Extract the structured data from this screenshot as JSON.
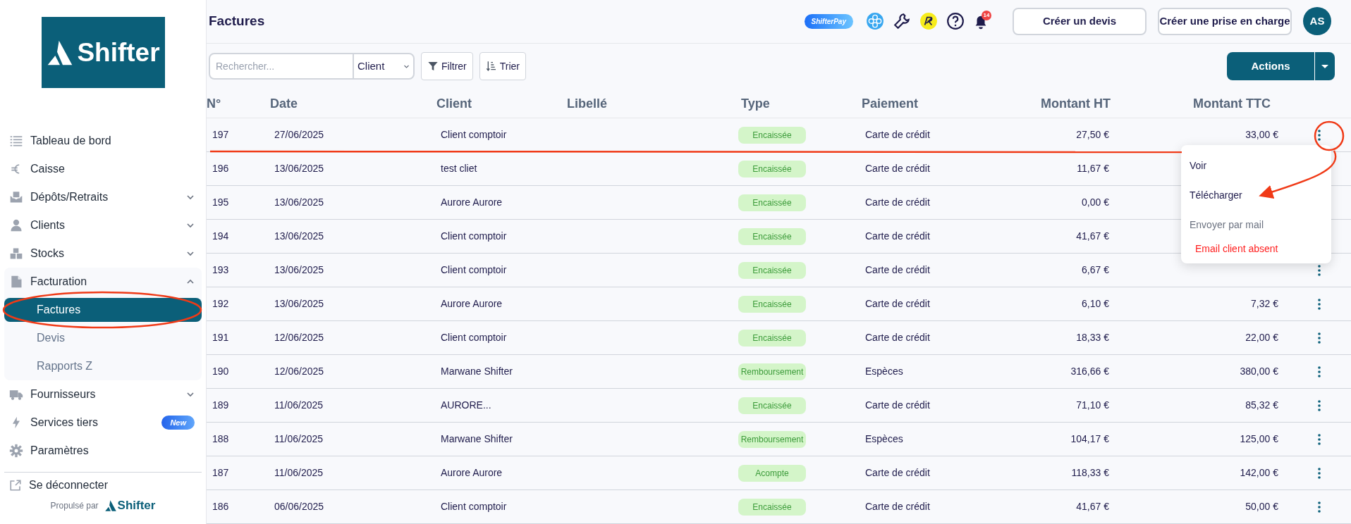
{
  "sidebar": {
    "logo": "Shifter",
    "items": [
      {
        "label": "Tableau de bord"
      },
      {
        "label": "Caisse"
      },
      {
        "label": "Dépôts/Retraits",
        "expanded": false
      },
      {
        "label": "Clients",
        "expanded": false
      },
      {
        "label": "Stocks",
        "expanded": false
      },
      {
        "label": "Facturation",
        "expanded": true,
        "children": [
          {
            "label": "Factures",
            "selected": true
          },
          {
            "label": "Devis",
            "selected": false
          },
          {
            "label": "Rapports Z",
            "selected": false
          }
        ]
      },
      {
        "label": "Fournisseurs",
        "expanded": false
      },
      {
        "label": "Services tiers",
        "badge": "New"
      },
      {
        "label": "Paramètres"
      }
    ],
    "logout": "Se déconnecter",
    "powered_by": "Propulsé par",
    "powered_logo": "Shifter"
  },
  "header": {
    "title": "Factures",
    "pay_badge": "ShifterPay",
    "notification_count": "14",
    "buttons": [
      "Créer un devis",
      "Créer une prise en charge"
    ],
    "avatar": "AS"
  },
  "toolbar": {
    "search": {
      "placeholder": "Rechercher..."
    },
    "search_field": "Client",
    "filter": "Filtrer",
    "sort": "Trier",
    "actions": "Actions"
  },
  "table": {
    "columns": [
      "N°",
      "Date",
      "Client",
      "Libellé",
      "Type",
      "Paiement",
      "Montant HT",
      "Montant TTC"
    ],
    "rows": [
      {
        "n": "197",
        "date": "27/06/2025",
        "client": "Client comptoir",
        "type": "Encaissée",
        "payment": "Carte de crédit",
        "ht": "27,50 €",
        "ttc": "33,00 €",
        "actions_visible": true
      },
      {
        "n": "196",
        "date": "13/06/2025",
        "client": "test cliet",
        "type": "Encaissée",
        "payment": "Carte de crédit",
        "ht": "11,67 €",
        "actions_visible": false
      },
      {
        "n": "195",
        "date": "13/06/2025",
        "client": "Aurore Aurore",
        "type": "Encaissée",
        "payment": "Carte de crédit",
        "ht": "0,00 €",
        "actions_visible": false
      },
      {
        "n": "194",
        "date": "13/06/2025",
        "client": "Client comptoir",
        "type": "Encaissée",
        "payment": "Carte de crédit",
        "ht": "41,67 €",
        "actions_visible": false
      },
      {
        "n": "193",
        "date": "13/06/2025",
        "client": "Client comptoir",
        "type": "Encaissée",
        "payment": "Carte de crédit",
        "ht": "6,67 €",
        "actions_visible": true
      },
      {
        "n": "192",
        "date": "13/06/2025",
        "client": "Aurore Aurore",
        "type": "Encaissée",
        "payment": "Carte de crédit",
        "ht": "6,10 €",
        "ttc": "7,32 €",
        "actions_visible": true
      },
      {
        "n": "191",
        "date": "12/06/2025",
        "client": "Client comptoir",
        "type": "Encaissée",
        "payment": "Carte de crédit",
        "ht": "18,33 €",
        "ttc": "22,00 €",
        "actions_visible": true
      },
      {
        "n": "190",
        "date": "12/06/2025",
        "client": "Marwane Shifter",
        "type": "Remboursement",
        "payment": "Espèces",
        "ht": "316,66 €",
        "ttc": "380,00 €",
        "actions_visible": true
      },
      {
        "n": "189",
        "date": "11/06/2025",
        "client": "AURORE...",
        "type": "Encaissée",
        "payment": "Carte de crédit",
        "ht": "71,10 €",
        "ttc": "85,32 €",
        "actions_visible": true
      },
      {
        "n": "188",
        "date": "11/06/2025",
        "client": "Marwane Shifter",
        "type": "Remboursement",
        "payment": "Espèces",
        "ht": "104,17 €",
        "ttc": "125,00 €",
        "actions_visible": true
      },
      {
        "n": "187",
        "date": "11/06/2025",
        "client": "Aurore Aurore",
        "type": "Acompte",
        "payment": "Carte de crédit",
        "ht": "118,33 €",
        "ttc": "142,00 €",
        "actions_visible": true
      },
      {
        "n": "186",
        "date": "06/06/2025",
        "client": "Client comptoir",
        "type": "Encaissée",
        "payment": "Carte de crédit",
        "ht": "41,67 €",
        "ttc": "50,00 €",
        "actions_visible": true
      }
    ]
  },
  "row_menu": {
    "items": [
      {
        "label": "Voir",
        "disabled": false
      },
      {
        "label": "Télécharger",
        "disabled": false
      },
      {
        "label": "Envoyer par mail",
        "disabled": true
      }
    ],
    "warning": "Email client absent"
  }
}
